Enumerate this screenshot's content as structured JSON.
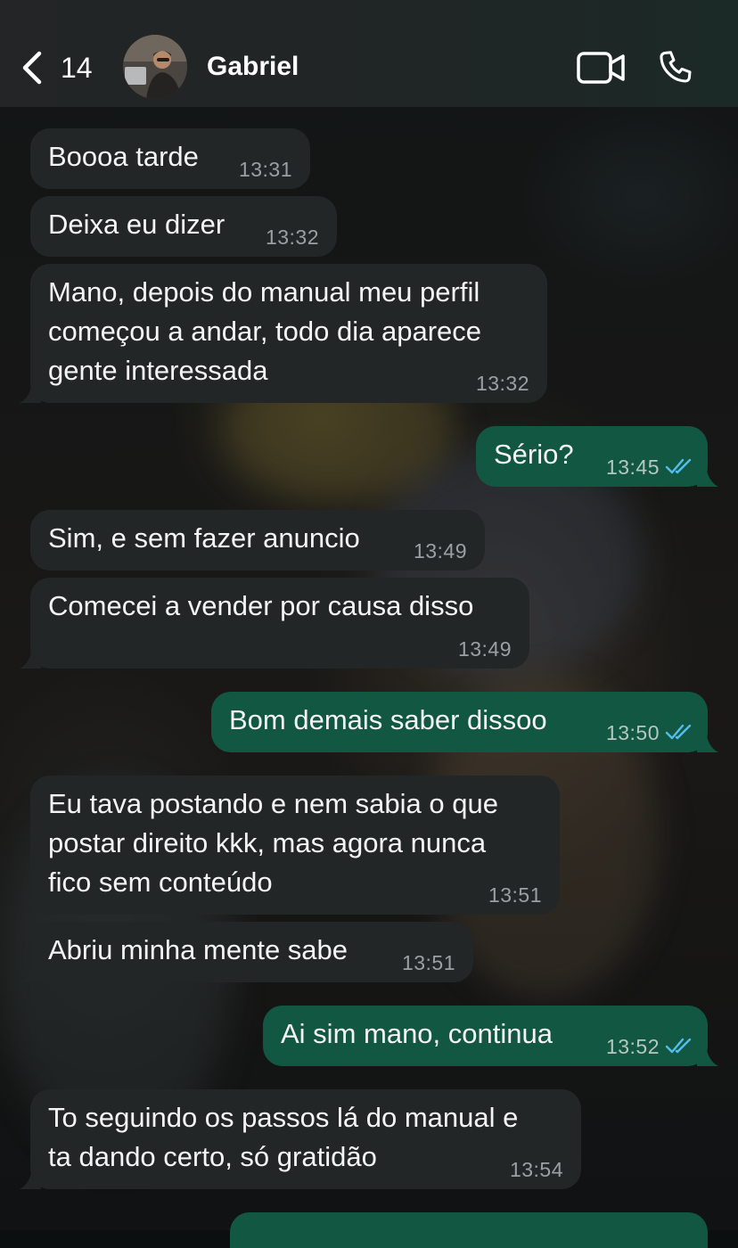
{
  "header": {
    "unread_count": "14",
    "contact_name": "Gabriel"
  },
  "colors": {
    "incoming_bubble": "#232627",
    "outgoing_bubble": "#115741",
    "read_ticks": "#53bdeb",
    "header_bg": "#232526"
  },
  "icons": {
    "back": "chevron-left-icon",
    "video": "video-camera-icon",
    "call": "phone-icon",
    "read": "double-check-icon"
  },
  "messages": [
    {
      "direction": "in",
      "text": "Boooa tarde",
      "time": "13:31"
    },
    {
      "direction": "in",
      "text": "Deixa eu dizer",
      "time": "13:32"
    },
    {
      "direction": "in",
      "text": "Mano, depois do manual meu perfil\ncomeçou a andar, todo dia aparece\ngente interessada",
      "time": "13:32"
    },
    {
      "direction": "out",
      "text": "Sério?",
      "time": "13:45",
      "status": "read"
    },
    {
      "direction": "in",
      "text": "Sim, e sem fazer anuncio",
      "time": "13:49"
    },
    {
      "direction": "in",
      "text": "Comecei a vender por causa disso",
      "time": "13:49"
    },
    {
      "direction": "out",
      "text": "Bom demais saber dissoo",
      "time": "13:50",
      "status": "read"
    },
    {
      "direction": "in",
      "text": "Eu tava postando e nem sabia o que\npostar direito kkk, mas agora nunca\nfico sem conteúdo",
      "time": "13:51"
    },
    {
      "direction": "in",
      "text": "Abriu minha mente sabe",
      "time": "13:51"
    },
    {
      "direction": "out",
      "text": "Ai sim mano, continua",
      "time": "13:52",
      "status": "read"
    },
    {
      "direction": "in",
      "text": "To seguindo os passos lá do manual e\nta dando certo, só gratidão",
      "time": "13:54"
    }
  ]
}
